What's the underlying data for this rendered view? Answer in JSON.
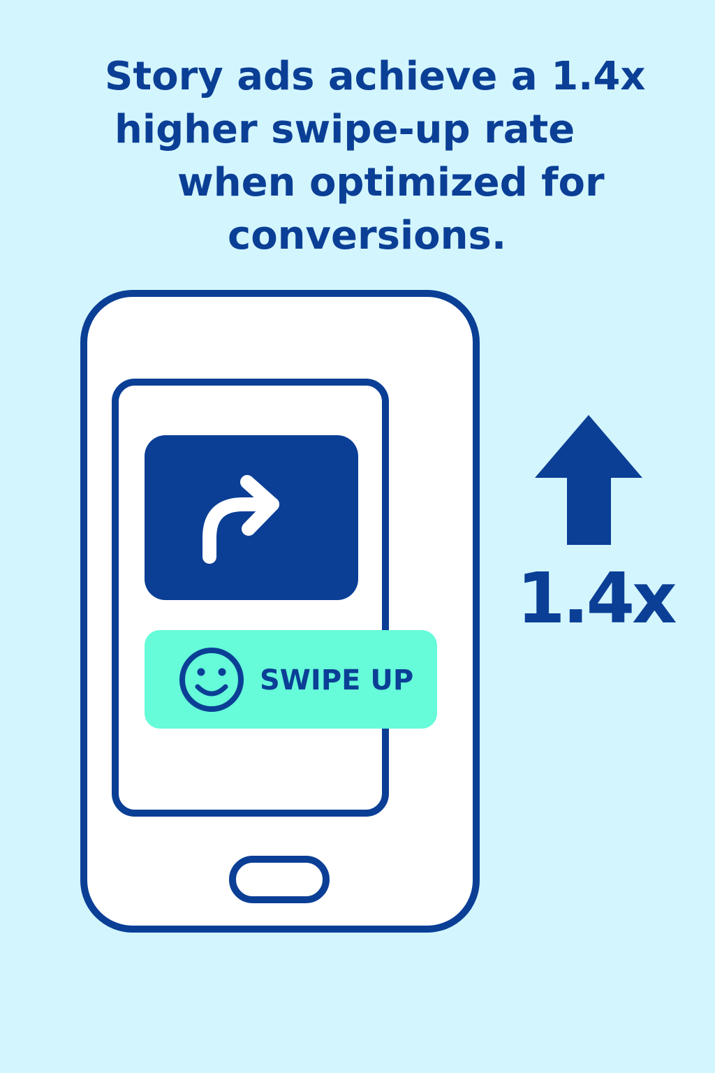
{
  "headline": {
    "lines": [
      "Story ads achieve a 1.4x",
      "higher swipe-up rate",
      "when optimized for",
      "conversions."
    ]
  },
  "phone": {
    "cta_label": "SWIPE UP"
  },
  "metric": {
    "value": "1.4x"
  },
  "colors": {
    "background": "#d3f5fd",
    "primary": "#0b3f96",
    "cta": "#66fbd9",
    "screen": "#ffffff"
  },
  "icons": [
    "turn-right-arrow-icon",
    "smiley-face-icon",
    "up-arrow-icon",
    "home-button"
  ]
}
